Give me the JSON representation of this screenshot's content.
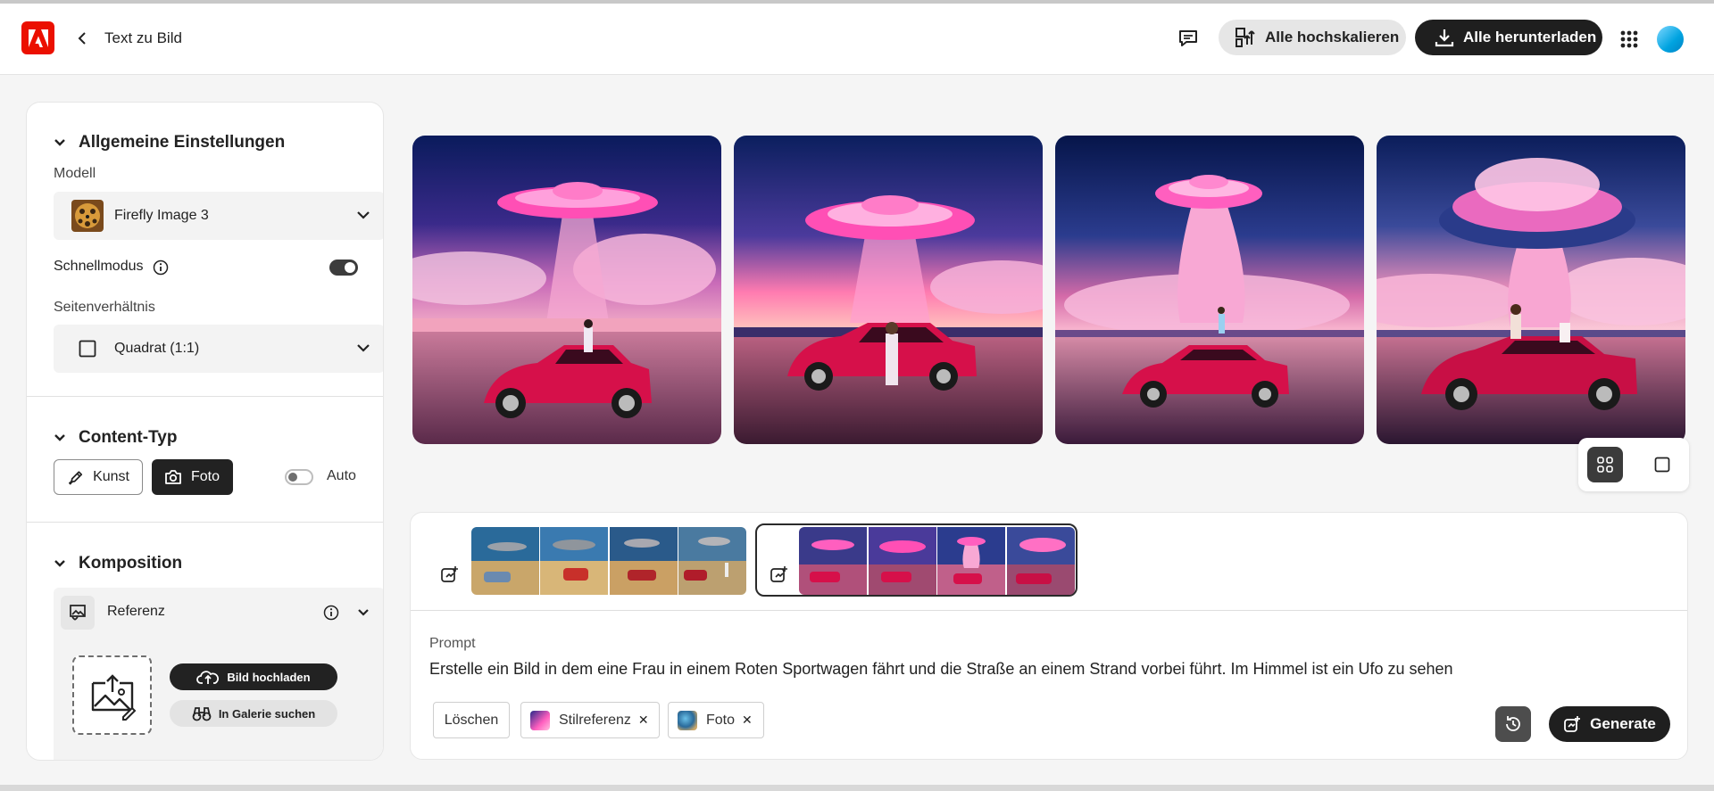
{
  "header": {
    "title": "Text zu Bild",
    "upscale_all": "Alle hochskalieren",
    "download_all": "Alle herunterladen"
  },
  "sidebar": {
    "general": {
      "heading": "Allgemeine Einstellungen",
      "model_label": "Modell",
      "model_value": "Firefly Image 3",
      "fast_mode_label": "Schnellmodus",
      "fast_mode_on": true,
      "aspect_label": "Seitenverhältnis",
      "aspect_value": "Quadrat (1:1)"
    },
    "content_type": {
      "heading": "Content-Typ",
      "art": "Kunst",
      "photo": "Foto",
      "selected": "Foto",
      "auto_label": "Auto",
      "auto_on": false
    },
    "composition": {
      "heading": "Komposition",
      "reference_label": "Referenz",
      "upload_button": "Bild hochladen",
      "gallery_button": "In Galerie suchen"
    }
  },
  "prompt": {
    "label": "Prompt",
    "text": "Erstelle ein Bild in dem eine Frau in einem Roten Sportwagen fährt und die Straße an einem Strand vorbei führt. Im Himmel ist ein Ufo zu sehen",
    "clear": "Löschen",
    "chips": [
      "Stilreferenz",
      "Foto"
    ],
    "generate": "Generate"
  },
  "colors": {
    "accent_dark": "#1f1f1f",
    "adobe_red": "#eb1000",
    "car": "#d6104a",
    "ufo_pink": "#ff5fbf"
  }
}
